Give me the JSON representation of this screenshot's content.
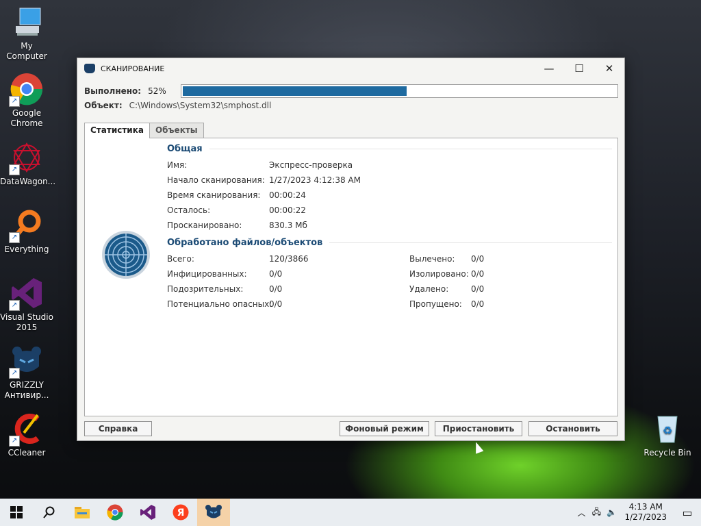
{
  "desktop": {
    "icons": [
      {
        "label": "My Computer",
        "icon": "computer-icon"
      },
      {
        "label": "Google\nChrome",
        "icon": "chrome-icon"
      },
      {
        "label": "DataWagon...",
        "icon": "datawagon-icon"
      },
      {
        "label": "Everything",
        "icon": "everything-icon"
      },
      {
        "label": "Visual Studio\n2015",
        "icon": "visual-studio-icon"
      },
      {
        "label": "GRIZZLY\nАнтивир...",
        "icon": "grizzly-icon"
      },
      {
        "label": "CCleaner",
        "icon": "ccleaner-icon"
      },
      {
        "label": "Recycle Bin",
        "icon": "recycle-bin-icon"
      }
    ]
  },
  "window": {
    "title": "СКАНИРОВАНИЕ",
    "progress_label": "Выполнено:",
    "progress_text": "52%",
    "progress_value": 0.52,
    "object_label": "Объект:",
    "object_value": "C:\\Windows\\System32\\smphost.dll",
    "tabs": [
      "Статистика",
      "Объекты"
    ],
    "general": {
      "heading": "Общая",
      "rows": [
        {
          "label": "Имя:",
          "value": "Экспресс-проверка"
        },
        {
          "label": "Начало сканирования:",
          "value": "1/27/2023 4:12:38 AM"
        },
        {
          "label": "Время сканирования:",
          "value": "00:00:24"
        },
        {
          "label": "Осталось:",
          "value": "00:00:22"
        },
        {
          "label": "Просканировано:",
          "value": "830.3 Мб"
        }
      ]
    },
    "processed": {
      "heading": "Обработано файлов/объектов",
      "left": [
        {
          "label": "Всего:",
          "value": "120/3866"
        },
        {
          "label": "Инфицированных:",
          "value": "0/0"
        },
        {
          "label": "Подозрительных:",
          "value": "0/0"
        },
        {
          "label": "Потенциально опасных:",
          "value": "0/0"
        }
      ],
      "right": [
        {
          "label": "Вылечено:",
          "value": "0/0"
        },
        {
          "label": "Изолировано:",
          "value": "0/0"
        },
        {
          "label": "Удалено:",
          "value": "0/0"
        },
        {
          "label": "Пропущено:",
          "value": "0/0"
        }
      ]
    },
    "buttons": {
      "help": "Справка",
      "background": "Фоновый режим",
      "pause": "Приостановить",
      "stop": "Остановить"
    }
  },
  "taskbar": {
    "time": "4:13 AM",
    "date": "1/27/2023"
  }
}
